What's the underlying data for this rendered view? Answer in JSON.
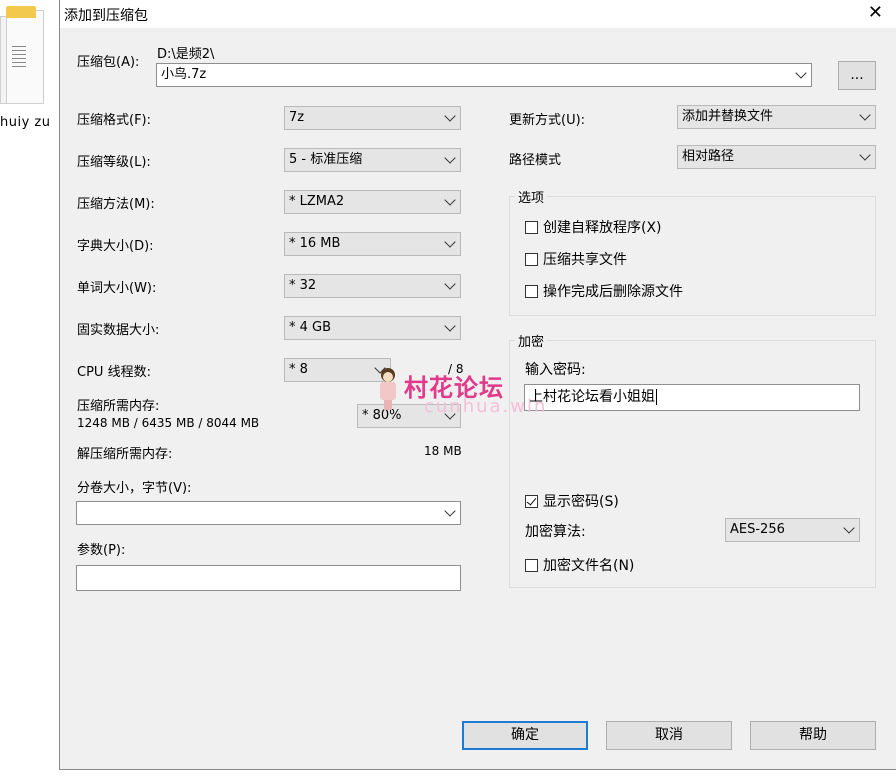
{
  "desktop": {
    "file_label": "huiy  zu"
  },
  "dialog": {
    "title": "添加到压缩包",
    "archive": {
      "label": "压缩包(A):",
      "path": "D:\\是频2\\",
      "name": "小鸟.7z",
      "browse_label": "..."
    },
    "left": {
      "format": {
        "label": "压缩格式(F):",
        "value": "7z"
      },
      "level": {
        "label": "压缩等级(L):",
        "value": "5 - 标准压缩"
      },
      "method": {
        "label": "压缩方法(M):",
        "value": "* LZMA2"
      },
      "dict": {
        "label": "字典大小(D):",
        "value": "* 16 MB"
      },
      "word": {
        "label": "单词大小(W):",
        "value": "* 32"
      },
      "solid": {
        "label": "固实数据大小:",
        "value": "* 4 GB"
      },
      "cpu": {
        "label": "CPU 线程数:",
        "value": "* 8",
        "max": "/ 8"
      },
      "mem": {
        "label": "压缩所需内存:",
        "detail": "1248 MB / 6435 MB / 8044 MB",
        "value": "* 80%"
      },
      "decomp": {
        "label": "解压缩所需内存:",
        "value": "18 MB"
      },
      "split": {
        "label": "分卷大小，字节(V):",
        "value": ""
      },
      "params": {
        "label": "参数(P):",
        "value": ""
      }
    },
    "right": {
      "update": {
        "label": "更新方式(U):",
        "value": "添加并替换文件"
      },
      "pathmode": {
        "label": "路径模式",
        "value": "相对路径"
      },
      "options": {
        "title": "选项",
        "sfx": {
          "label": "创建自释放程序(X)",
          "checked": false
        },
        "shared": {
          "label": "压缩共享文件",
          "checked": false
        },
        "delete": {
          "label": "操作完成后删除源文件",
          "checked": false
        }
      },
      "encryption": {
        "title": "加密",
        "password_label": "输入密码:",
        "password_value": "上村花论坛看小姐姐",
        "show": {
          "label": "显示密码(S)",
          "checked": true
        },
        "method_label": "加密算法:",
        "method_value": "AES-256",
        "encrypt_names": {
          "label": "加密文件名(N)",
          "checked": false
        }
      }
    },
    "buttons": {
      "ok": "确定",
      "cancel": "取消",
      "help": "帮助"
    }
  },
  "watermark": {
    "cn": "村花论坛",
    "en": "cunhua.win"
  },
  "colors": {
    "dialog_bg": "#f0f0f0",
    "accent": "#1e7bd1",
    "watermark": "#e23a8a"
  }
}
